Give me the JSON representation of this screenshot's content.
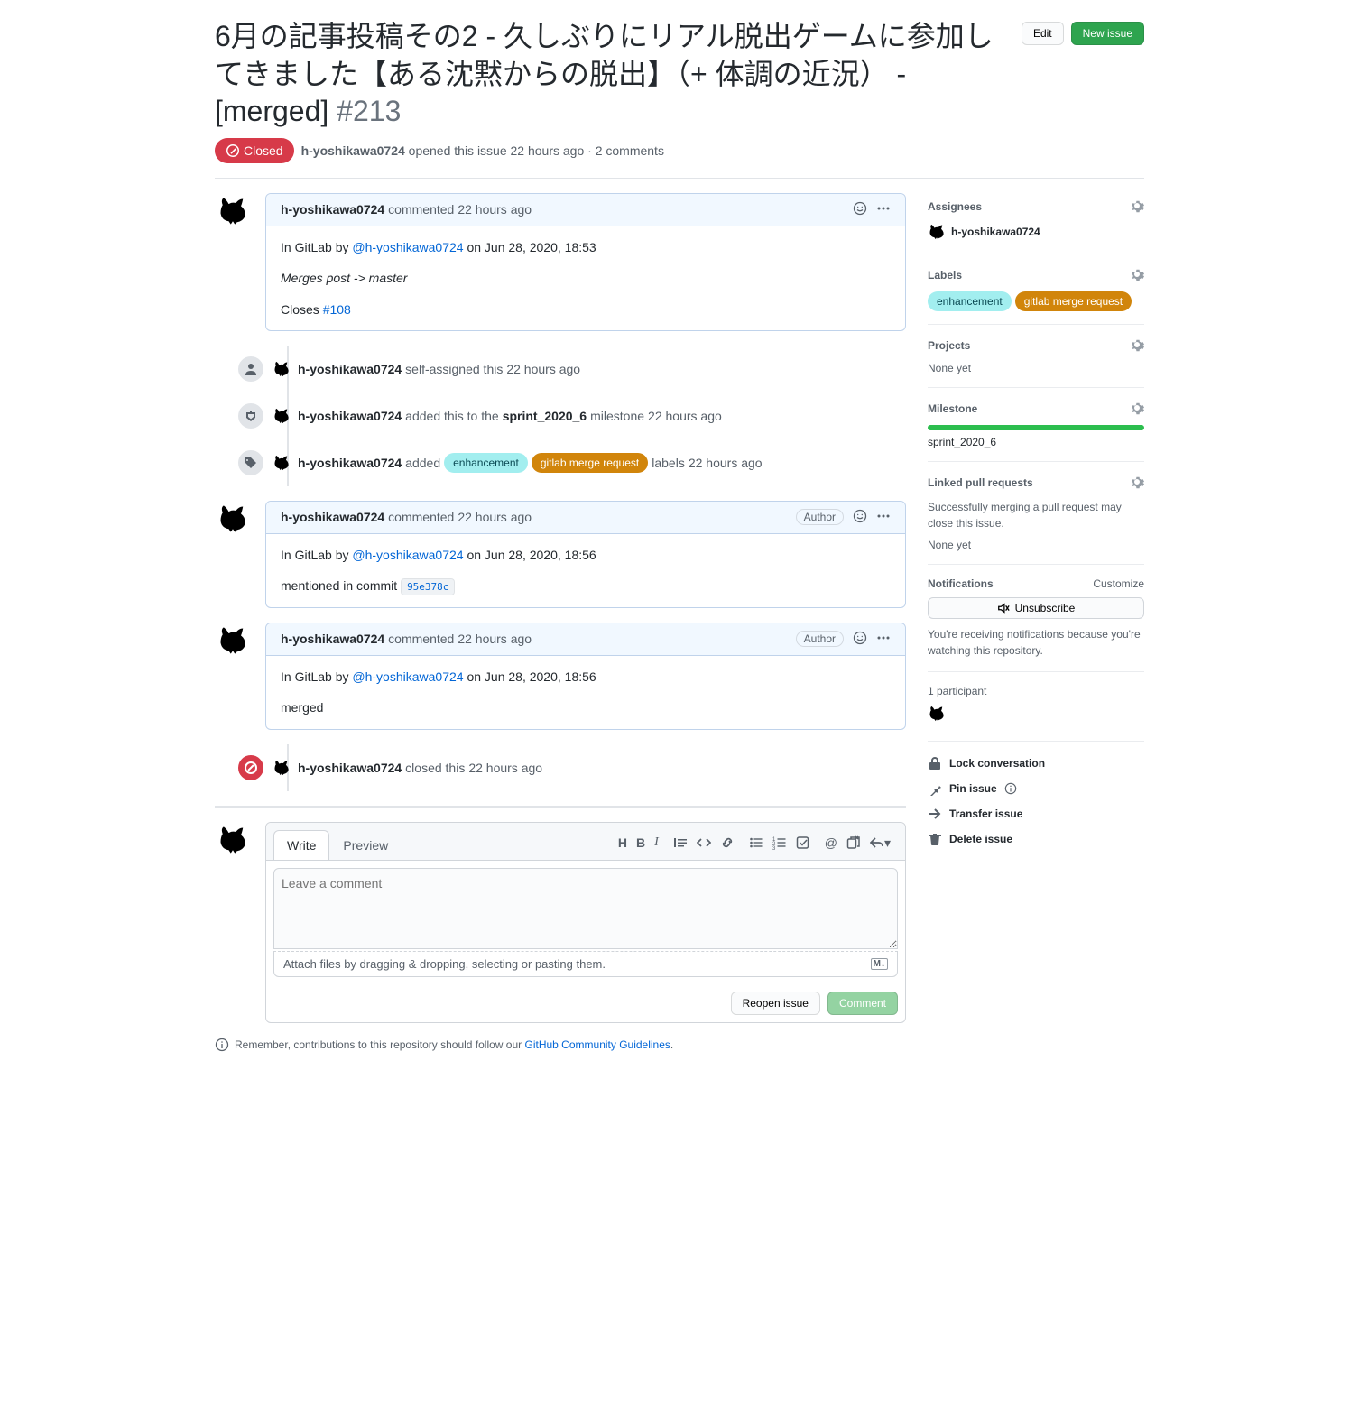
{
  "issue": {
    "title": "6月の記事投稿その2 - 久しぶりにリアル脱出ゲームに参加してきました【ある沈黙からの脱出】（+ 体調の近況） - [merged]",
    "number": "#213",
    "state": "Closed",
    "author": "h-yoshikawa0724",
    "opened_text_prefix": "opened this issue",
    "opened_ago": "22 hours ago",
    "comments_count": "2 comments"
  },
  "header_buttons": {
    "edit": "Edit",
    "new_issue": "New issue"
  },
  "comments": [
    {
      "author": "h-yoshikawa0724",
      "commented": "commented",
      "ago": "22 hours ago",
      "show_author_badge": false,
      "body_prefix": "In GitLab by ",
      "body_handle": "@h-yoshikawa0724",
      "body_suffix": " on Jun 28, 2020, 18:53",
      "merges_line": "Merges post -> master",
      "closes_prefix": "Closes ",
      "closes_link": "#108"
    },
    {
      "author": "h-yoshikawa0724",
      "commented": "commented",
      "ago": "22 hours ago",
      "show_author_badge": true,
      "author_badge": "Author",
      "body_prefix": "In GitLab by ",
      "body_handle": "@h-yoshikawa0724",
      "body_suffix": " on Jun 28, 2020, 18:56",
      "mention_prefix": "mentioned in commit ",
      "commit_sha": "95e378c"
    },
    {
      "author": "h-yoshikawa0724",
      "commented": "commented",
      "ago": "22 hours ago",
      "show_author_badge": true,
      "author_badge": "Author",
      "body_prefix": "In GitLab by ",
      "body_handle": "@h-yoshikawa0724",
      "body_suffix": " on Jun 28, 2020, 18:56",
      "merged_text": "merged"
    }
  ],
  "events": {
    "self_assigned": {
      "user": "h-yoshikawa0724",
      "action": "self-assigned this",
      "ago": "22 hours ago"
    },
    "milestone": {
      "user": "h-yoshikawa0724",
      "prefix": "added this to the ",
      "milestone": "sprint_2020_6",
      "suffix": " milestone",
      "ago": "22 hours ago"
    },
    "labels": {
      "user": "h-yoshikawa0724",
      "prefix": "added",
      "label1": "enhancement",
      "label2": "gitlab merge request",
      "suffix": "labels",
      "ago": "22 hours ago"
    },
    "closed": {
      "user": "h-yoshikawa0724",
      "action": "closed this",
      "ago": "22 hours ago"
    }
  },
  "editor": {
    "tab_write": "Write",
    "tab_preview": "Preview",
    "placeholder": "Leave a comment",
    "attach_hint": "Attach files by dragging & dropping, selecting or pasting them.",
    "reopen_btn": "Reopen issue",
    "comment_btn": "Comment"
  },
  "guideline": {
    "prefix": "Remember, contributions to this repository should follow our ",
    "link": "GitHub Community Guidelines",
    "suffix": "."
  },
  "sidebar": {
    "assignees": {
      "title": "Assignees",
      "user": "h-yoshikawa0724"
    },
    "labels": {
      "title": "Labels",
      "l1": "enhancement",
      "l2": "gitlab merge request"
    },
    "projects": {
      "title": "Projects",
      "value": "None yet"
    },
    "milestone": {
      "title": "Milestone",
      "value": "sprint_2020_6"
    },
    "linked": {
      "title": "Linked pull requests",
      "desc": "Successfully merging a pull request may close this issue.",
      "value": "None yet"
    },
    "notifications": {
      "title": "Notifications",
      "customize": "Customize",
      "btn": "Unsubscribe",
      "desc": "You're receiving notifications because you're watching this repository."
    },
    "participants": {
      "title": "1 participant"
    },
    "actions": {
      "lock": "Lock conversation",
      "pin": "Pin issue",
      "transfer": "Transfer issue",
      "delete": "Delete issue"
    }
  }
}
